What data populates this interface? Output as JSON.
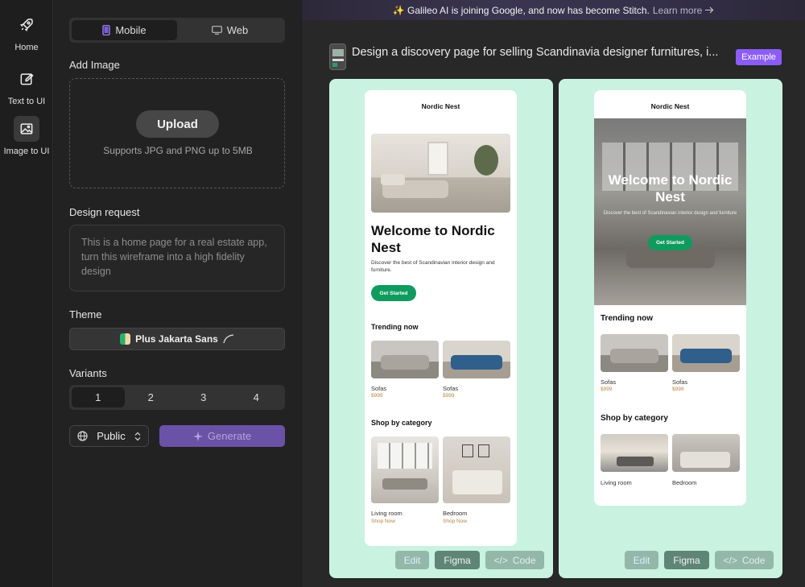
{
  "nav": [
    {
      "label": "Home",
      "icon": "rocket-icon"
    },
    {
      "label": "Text to UI",
      "icon": "edit-icon"
    },
    {
      "label": "Image to UI",
      "icon": "image-icon"
    }
  ],
  "platform": {
    "mobile": "Mobile",
    "web": "Web"
  },
  "add_image": {
    "label": "Add Image",
    "upload": "Upload",
    "hint": "Supports JPG and PNG up to 5MB"
  },
  "design_request": {
    "label": "Design request",
    "placeholder": "This is a home page for a real estate app, turn this wireframe into a high fidelity design"
  },
  "theme": {
    "label": "Theme",
    "font": "Plus Jakarta Sans"
  },
  "variants": {
    "label": "Variants",
    "options": [
      "1",
      "2",
      "3",
      "4"
    ],
    "selected": "1"
  },
  "visibility": "Public",
  "generate": "Generate",
  "banner": {
    "text": "✨ Galileo AI is joining Google, and now has become Stitch.",
    "link": "Learn more"
  },
  "prompt": {
    "text": "Design a discovery page for selling Scandinavia designer furnitures, i...",
    "badge": "Example"
  },
  "design1": {
    "brand": "Nordic Nest",
    "headline": "Welcome to Nordic Nest",
    "sub": "Discover the best of Scandinavian interior design and furniture.",
    "cta": "Get Started",
    "trending": "Trending now",
    "items": [
      {
        "name": "Sofas",
        "price": "$999"
      },
      {
        "name": "Sofas",
        "price": "$999"
      }
    ],
    "shop": "Shop by category",
    "cats": [
      {
        "name": "Living room",
        "link": "Shop Now"
      },
      {
        "name": "Bedroom",
        "link": "Shop Now"
      }
    ]
  },
  "design2": {
    "brand": "Nordic Nest",
    "headline": "Welcome to Nordic Nest",
    "sub": "Discover the best of Scandinavian interior design and furniture",
    "cta": "Get Started",
    "trending": "Trending now",
    "items": [
      {
        "name": "Sofas",
        "price": "$999"
      },
      {
        "name": "Sofas",
        "price": "$999"
      }
    ],
    "shop": "Shop by category",
    "cats": [
      {
        "name": "Living room"
      },
      {
        "name": "Bedroom"
      }
    ]
  },
  "actions": {
    "edit": "Edit",
    "figma": "Figma",
    "code": "Code"
  },
  "colors": {
    "accent": "#8b5cf6",
    "generate": "#6a52a6",
    "card": "#c9f2e1",
    "cta": "#0f9b5e"
  }
}
